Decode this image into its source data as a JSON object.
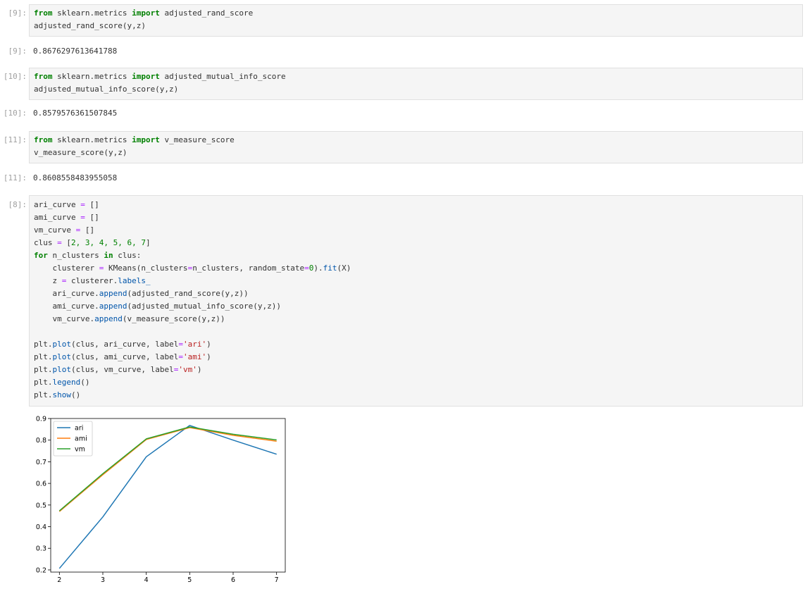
{
  "cells": {
    "c9": {
      "in_prompt": "[9]:",
      "out_prompt": "[9]:",
      "line1": {
        "kw1": "from",
        "mod": " sklearn.metrics ",
        "kw2": "import",
        "name": " adjusted_rand_score"
      },
      "line2": "adjusted_rand_score(y,z)",
      "output": "0.8676297613641788"
    },
    "c10": {
      "in_prompt": "[10]:",
      "out_prompt": "[10]:",
      "line1": {
        "kw1": "from",
        "mod": " sklearn.metrics ",
        "kw2": "import",
        "name": " adjusted_mutual_info_score"
      },
      "line2": "adjusted_mutual_info_score(y,z)",
      "output": "0.8579576361507845"
    },
    "c11": {
      "in_prompt": "[11]:",
      "out_prompt": "[11]:",
      "line1": {
        "kw1": "from",
        "mod": " sklearn.metrics ",
        "kw2": "import",
        "name": " v_measure_score"
      },
      "line2": "v_measure_score(y,z)",
      "output": "0.8608558483955058"
    },
    "c8": {
      "in_prompt": "[8]:",
      "lines": {
        "l1a": "ari_curve ",
        "l1b": "=",
        "l1c": " []",
        "l2a": "ami_curve ",
        "l2b": "=",
        "l2c": " []",
        "l3a": "vm_curve ",
        "l3b": "=",
        "l3c": " []",
        "l4a": "clus ",
        "l4b": "=",
        "l4c": " [",
        "l4n": "2, 3, 4, 5, 6, 7",
        "l4d": "]",
        "l5kw": "for",
        "l5a": " n_clusters ",
        "l5in": "in",
        "l5b": " clus:",
        "l6a": "    clusterer ",
        "l6b": "=",
        "l6c": " KMeans(n_clusters",
        "l6d": "=",
        "l6e": "n_clusters, random_state",
        "l6f": "=",
        "l6g": "0",
        "l6h": ").",
        "l6i": "fit",
        "l6j": "(X)",
        "l7a": "    z ",
        "l7b": "=",
        "l7c": " clusterer.",
        "l7d": "labels_",
        "l8a": "    ari_curve.",
        "l8b": "append",
        "l8c": "(adjusted_rand_score(y,z))",
        "l9a": "    ami_curve.",
        "l9b": "append",
        "l9c": "(adjusted_mutual_info_score(y,z))",
        "l10a": "    vm_curve.",
        "l10b": "append",
        "l10c": "(v_measure_score(y,z))",
        "l12a": "plt.",
        "l12b": "plot",
        "l12c": "(clus, ari_curve, label",
        "l12d": "=",
        "l12e": "'ari'",
        "l12f": ")",
        "l13a": "plt.",
        "l13b": "plot",
        "l13c": "(clus, ami_curve, label",
        "l13d": "=",
        "l13e": "'ami'",
        "l13f": ")",
        "l14a": "plt.",
        "l14b": "plot",
        "l14c": "(clus, vm_curve, label",
        "l14d": "=",
        "l14e": "'vm'",
        "l14f": ")",
        "l15a": "plt.",
        "l15b": "legend",
        "l15c": "()",
        "l16a": "plt.",
        "l16b": "show",
        "l16c": "()"
      }
    }
  },
  "colors": {
    "ari": "#1f77b4",
    "ami": "#ff7f0e",
    "vm": "#2ca02c"
  },
  "chart_data": {
    "type": "line",
    "x": [
      2,
      3,
      4,
      5,
      6,
      7
    ],
    "series": [
      {
        "name": "ari",
        "values": [
          0.207,
          0.445,
          0.723,
          0.868,
          0.8,
          0.735
        ]
      },
      {
        "name": "ami",
        "values": [
          0.47,
          0.64,
          0.803,
          0.858,
          0.822,
          0.795
        ]
      },
      {
        "name": "vm",
        "values": [
          0.473,
          0.645,
          0.806,
          0.861,
          0.827,
          0.801
        ]
      }
    ],
    "xticks": [
      "2",
      "3",
      "4",
      "5",
      "6",
      "7"
    ],
    "yticks": [
      "0.2",
      "0.3",
      "0.4",
      "0.5",
      "0.6",
      "0.7",
      "0.8",
      "0.9"
    ],
    "xlim": [
      1.8,
      7.2
    ],
    "ylim": [
      0.19,
      0.9
    ],
    "legend": "top-left",
    "grid": false
  }
}
